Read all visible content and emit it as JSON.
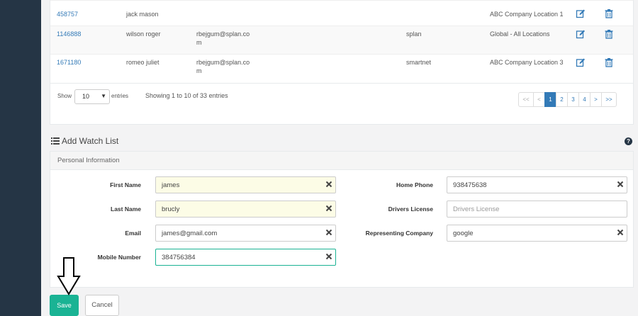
{
  "table": {
    "rows": [
      {
        "id": "458757",
        "name": "jack mason",
        "email": "",
        "representing": "",
        "location": "ABC Company Location 1"
      },
      {
        "id": "1146888",
        "name": "wilson roger",
        "email": "rbejgum@splan.com",
        "representing": "splan",
        "location": "Global - All Locations"
      },
      {
        "id": "1671180",
        "name": "romeo juliet",
        "email": "rbejgum@splan.com",
        "representing": "smartnet",
        "location": "ABC Company Location 3"
      }
    ],
    "show_label": "Show",
    "page_size": "10",
    "entries_label": "entries",
    "info": "Showing 1 to 10 of 33 entries",
    "pager": {
      "first": "<<",
      "prev": "<",
      "pages": [
        "1",
        "2",
        "3",
        "4"
      ],
      "next": ">",
      "last": ">>",
      "active": "1"
    }
  },
  "form": {
    "title": "Add Watch List",
    "section": "Personal Information",
    "first_name": {
      "label": "First Name",
      "value": "james"
    },
    "last_name": {
      "label": "Last Name",
      "value": "brucly"
    },
    "email": {
      "label": "Email",
      "value": "james@gmail.com"
    },
    "mobile": {
      "label": "Mobile Number",
      "value": "384756384"
    },
    "home_phone": {
      "label": "Home Phone",
      "value": "938475638"
    },
    "drivers_license": {
      "label": "Drivers License",
      "placeholder": "Drivers License",
      "value": ""
    },
    "representing_company": {
      "label": "Representing Company",
      "value": "google"
    }
  },
  "buttons": {
    "save": "Save",
    "cancel": "Cancel"
  },
  "colors": {
    "sidebar": "#253545",
    "primary": "#1ab394",
    "link": "#337ab7",
    "filled_field": "#fcfce6"
  }
}
